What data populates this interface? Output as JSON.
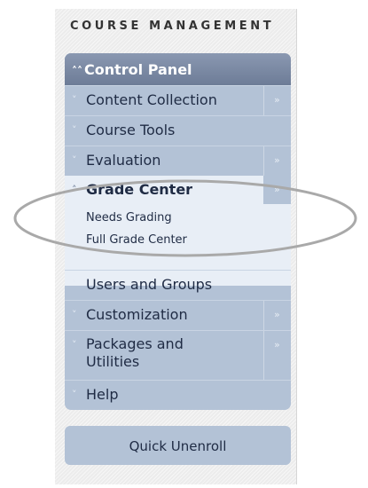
{
  "section_title": "COURSE MANAGEMENT",
  "control_panel": {
    "header": "Control Panel",
    "header_icon": "chevron-double-up-icon",
    "items_top": [
      {
        "label": "Content Collection",
        "has_more": true
      },
      {
        "label": "Course Tools",
        "has_more": false
      },
      {
        "label": "Evaluation",
        "has_more": true
      }
    ],
    "grade_center": {
      "label": "Grade Center",
      "subitems": [
        "Needs Grading",
        "Full Grade Center"
      ]
    },
    "items_bottom": [
      {
        "label": "Users and Groups",
        "has_more": false
      },
      {
        "label": "Customization",
        "has_more": true
      },
      {
        "label_line1": "Packages and",
        "label_line2": "Utilities",
        "has_more": true
      },
      {
        "label": "Help",
        "has_more": false
      }
    ]
  },
  "quick_unenroll": "Quick Unenroll",
  "colors": {
    "header_bg": "#7e8ca6",
    "menu_bg": "#b3c2d6",
    "active_bg": "#e8eef6",
    "text": "#1f2b44",
    "annotation": "#999999"
  }
}
